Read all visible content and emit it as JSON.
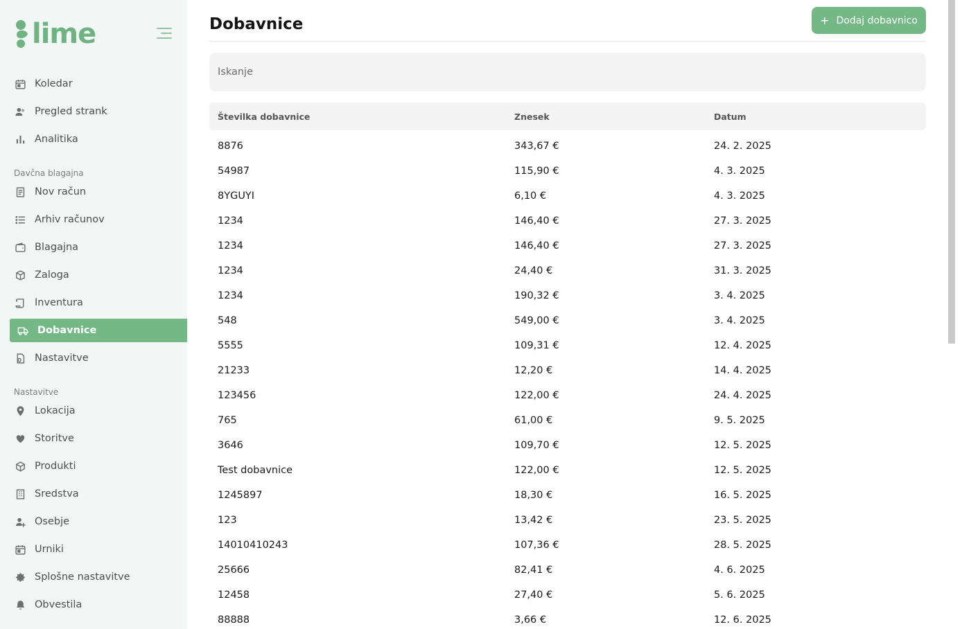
{
  "app": {
    "logo_text": "lime",
    "brand_color": "#74b886"
  },
  "sidebar": {
    "items_top": [
      {
        "label": "Koledar",
        "icon": "calendar-icon"
      },
      {
        "label": "Pregled strank",
        "icon": "users-icon"
      },
      {
        "label": "Analitika",
        "icon": "bar-chart-icon"
      }
    ],
    "section_register": "Davčna blagajna",
    "items_register": [
      {
        "label": "Nov račun",
        "icon": "receipt-icon"
      },
      {
        "label": "Arhiv računov",
        "icon": "list-icon"
      },
      {
        "label": "Blagajna",
        "icon": "wallet-icon"
      },
      {
        "label": "Zaloga",
        "icon": "boxes-icon"
      },
      {
        "label": "Inventura",
        "icon": "scroll-icon"
      },
      {
        "label": "Dobavnice",
        "icon": "truck-icon",
        "active": true
      },
      {
        "label": "Nastavitve",
        "icon": "file-settings-icon"
      }
    ],
    "section_settings": "Nastavitve",
    "items_settings": [
      {
        "label": "Lokacija",
        "icon": "map-pin-icon"
      },
      {
        "label": "Storitve",
        "icon": "heart-hand-icon"
      },
      {
        "label": "Produkti",
        "icon": "package-icon"
      },
      {
        "label": "Sredstva",
        "icon": "building-icon"
      },
      {
        "label": "Osebje",
        "icon": "user-plus-icon"
      },
      {
        "label": "Urniki",
        "icon": "calendar-icon"
      },
      {
        "label": "Splošne nastavitve",
        "icon": "gear-icon"
      },
      {
        "label": "Obvestila",
        "icon": "bell-icon"
      }
    ]
  },
  "main": {
    "title": "Dobavnice",
    "add_button": "Dodaj dobavnico",
    "search_placeholder": "Iskanje",
    "columns": [
      "Številka dobavnice",
      "Znesek",
      "Datum"
    ],
    "rows": [
      [
        "8876",
        "343,67 €",
        "24. 2. 2025"
      ],
      [
        "54987",
        "115,90 €",
        "4. 3. 2025"
      ],
      [
        "8YGUYI",
        "6,10 €",
        "4. 3. 2025"
      ],
      [
        "1234",
        "146,40 €",
        "27. 3. 2025"
      ],
      [
        "1234",
        "146,40 €",
        "27. 3. 2025"
      ],
      [
        "1234",
        "24,40 €",
        "31. 3. 2025"
      ],
      [
        "1234",
        "190,32 €",
        "3. 4. 2025"
      ],
      [
        "548",
        "549,00 €",
        "3. 4. 2025"
      ],
      [
        "5555",
        "109,31 €",
        "12. 4. 2025"
      ],
      [
        "21233",
        "12,20 €",
        "14. 4. 2025"
      ],
      [
        "123456",
        "122,00 €",
        "24. 4. 2025"
      ],
      [
        "765",
        "61,00 €",
        "9. 5. 2025"
      ],
      [
        "3646",
        "109,70 €",
        "12. 5. 2025"
      ],
      [
        "Test dobavnice",
        "122,00 €",
        "12. 5. 2025"
      ],
      [
        "1245897",
        "18,30 €",
        "16. 5. 2025"
      ],
      [
        "123",
        "13,42 €",
        "23. 5. 2025"
      ],
      [
        "14010410243",
        "107,36 €",
        "28. 5. 2025"
      ],
      [
        "25666",
        "82,41 €",
        "4. 6. 2025"
      ],
      [
        "12458",
        "27,40 €",
        "5. 6. 2025"
      ],
      [
        "88888",
        "3,66 €",
        "12. 6. 2025"
      ]
    ]
  }
}
